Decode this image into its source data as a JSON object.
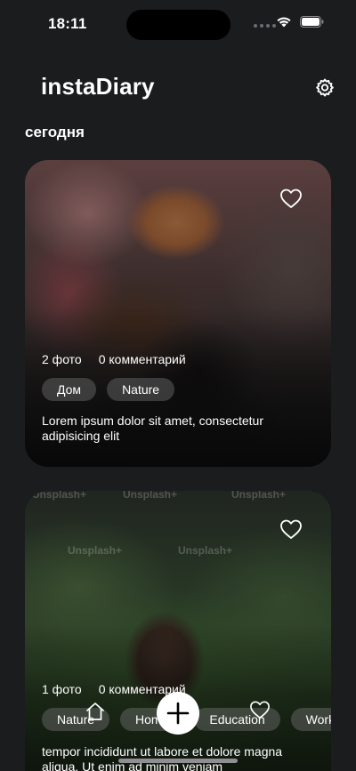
{
  "status_bar": {
    "time": "18:11"
  },
  "header": {
    "title": "instaDiary",
    "settings_icon": "gear-icon"
  },
  "section": {
    "title": "сегодня"
  },
  "entries": [
    {
      "photo_count": "2 фото",
      "comment_count": "0 комментарий",
      "tags": [
        "Дом",
        "Nature"
      ],
      "text": "Lorem ipsum dolor sit amet, consectetur adipisicing elit",
      "liked": false
    },
    {
      "photo_count": "1 фото",
      "comment_count": "0 комментарий",
      "tags": [
        "Nature",
        "Home",
        "Education",
        "Work"
      ],
      "text": "tempor incididunt ut labore et dolore magna aliqua. Ut enim ad minim veniam",
      "watermark": "Unsplash+",
      "liked": false
    }
  ],
  "tab_bar": {
    "home_icon": "home-icon",
    "add_icon": "plus-icon",
    "favorites_icon": "heart-icon"
  },
  "colors": {
    "background": "#1b1c1e",
    "tag_background": "#5a5a5a",
    "add_button": "#ffffff"
  }
}
